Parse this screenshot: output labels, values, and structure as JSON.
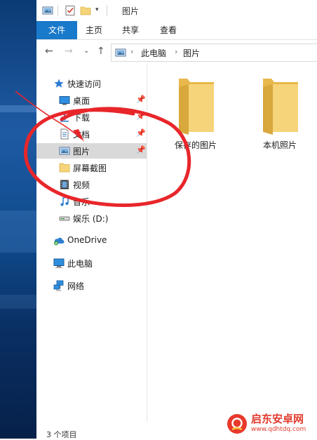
{
  "window": {
    "title": "图片"
  },
  "ribbon": {
    "tabs": [
      {
        "label": "文件"
      },
      {
        "label": "主页"
      },
      {
        "label": "共享"
      },
      {
        "label": "查看"
      }
    ]
  },
  "address": {
    "crumbs": [
      "此电脑",
      "图片"
    ]
  },
  "nav": {
    "items": [
      {
        "label": "快速访问",
        "icon": "star-icon"
      },
      {
        "label": "桌面",
        "icon": "desktop-icon",
        "pinned": true
      },
      {
        "label": "下载",
        "icon": "download-icon",
        "pinned": true
      },
      {
        "label": "文档",
        "icon": "document-icon",
        "pinned": true
      },
      {
        "label": "图片",
        "icon": "pictures-icon",
        "pinned": true,
        "selected": true
      },
      {
        "label": "屏幕截图",
        "icon": "folder-icon"
      },
      {
        "label": "视频",
        "icon": "video-icon"
      },
      {
        "label": "音乐",
        "icon": "music-icon"
      },
      {
        "label": "娱乐 (D:)",
        "icon": "drive-icon"
      },
      {
        "label": "OneDrive",
        "icon": "cloud-icon"
      },
      {
        "label": "此电脑",
        "icon": "computer-icon"
      },
      {
        "label": "网络",
        "icon": "network-icon"
      }
    ]
  },
  "content": {
    "folders": [
      {
        "label": "保存的图片"
      },
      {
        "label": "本机照片"
      }
    ]
  },
  "status": {
    "text": "3 个项目"
  },
  "watermark": {
    "title": "启东安卓网",
    "url": "www.qdhtdq.com"
  },
  "colors": {
    "accent": "#1979ca",
    "annotation": "#e8262a",
    "folder": "#f6d47a"
  }
}
